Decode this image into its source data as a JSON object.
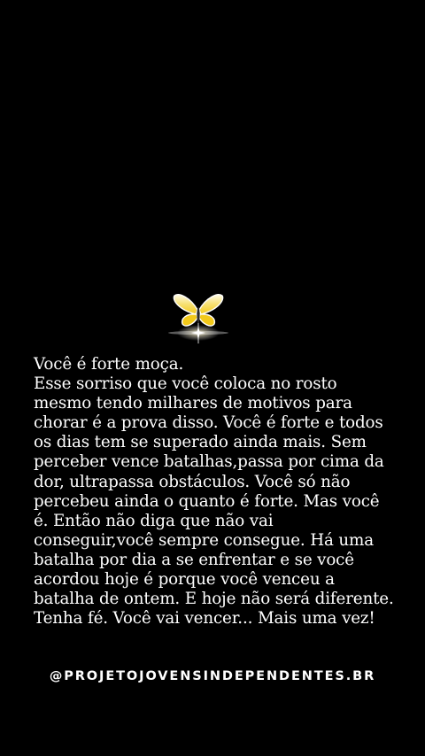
{
  "colors": {
    "background": "#000000",
    "text": "#ffffff",
    "butterfly_wing": "#f2d21b",
    "butterfly_edge": "#fff7c4",
    "glow": "#ffffff"
  },
  "icon": "butterfly-icon",
  "message": {
    "lines": [
      "Você é forte moça.",
      "Esse sorriso que você coloca no rosto",
      "mesmo tendo milhares de motivos para",
      "chorar é a prova disso. Você é forte e todos",
      "os dias tem se superado ainda mais. Sem",
      "perceber vence batalhas,passa por cima da",
      "dor, ultrapassa obstáculos. Você só não",
      "percebeu ainda o quanto é forte. Mas você",
      "é. Então não diga que não vai",
      "conseguir,você sempre consegue. Há uma",
      "batalha por dia a se enfrentar e se você",
      "acordou hoje é porque você venceu a",
      "batalha de ontem. E hoje não será diferente.",
      "Tenha fé. Você vai vencer... Mais uma vez!"
    ]
  },
  "handle": "@PROJETOJOVENSINDEPENDENTES.BR"
}
